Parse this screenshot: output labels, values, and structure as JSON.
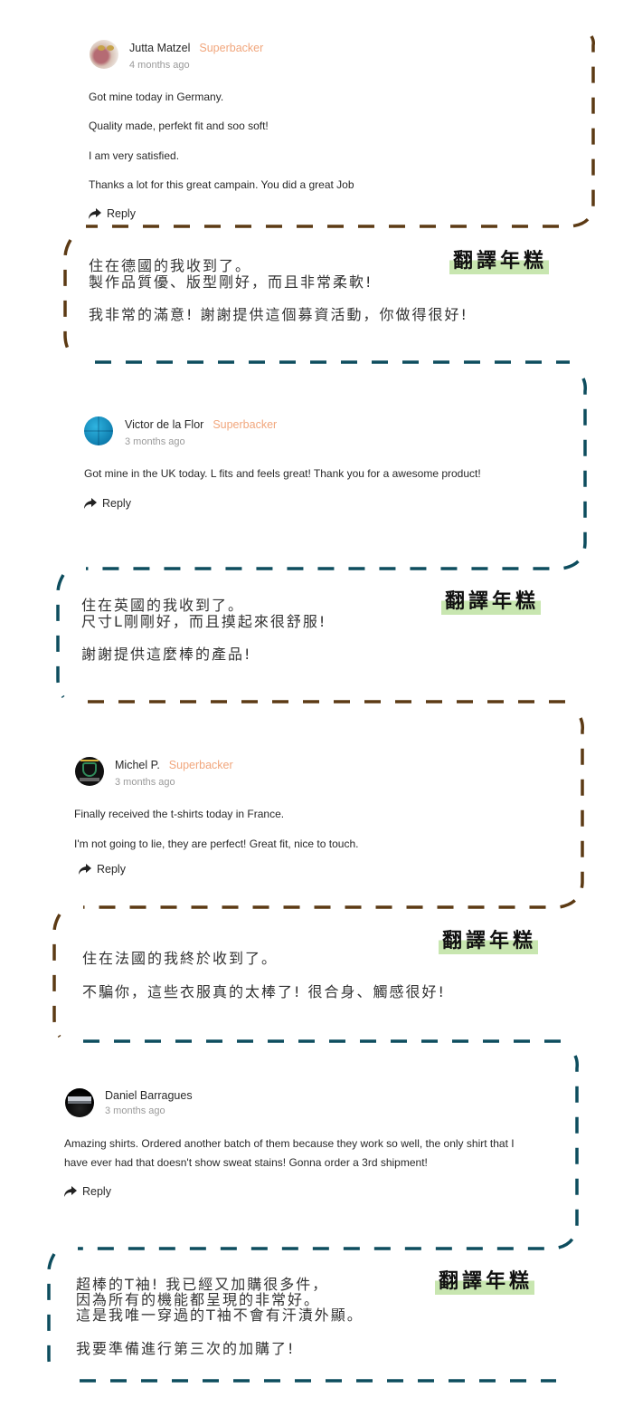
{
  "reply_label": "Reply",
  "translator_label": "翻譯年糕",
  "colors": {
    "brown_dash": "#5c3a14",
    "teal_dash": "#0d4d5e",
    "badge": "#f1a67c",
    "highlight": "#c8e6b0"
  },
  "comments": [
    {
      "author": "Jutta Matzel",
      "badge": "Superbacker",
      "time": "4 months ago",
      "body": [
        "Got mine today in Germany.",
        "Quality made, perfekt fit and soo soft!",
        "I am very satisfied.",
        "Thanks a lot for this great campain. You did a great Job"
      ],
      "translation": [
        "住在德國的我收到了。",
        "製作品質優、版型剛好，而且非常柔軟!",
        "我非常的滿意! 謝謝提供這個募資活動，你做得很好!"
      ]
    },
    {
      "author": "Victor de la Flor",
      "badge": "Superbacker",
      "time": "3 months ago",
      "body": [
        "Got mine in the UK today. L fits and feels great! Thank you for a awesome product!"
      ],
      "translation": [
        "住在英國的我收到了。",
        "尺寸L剛剛好，而且摸起來很舒服!",
        "謝謝提供這麼棒的產品!"
      ]
    },
    {
      "author": "Michel P.",
      "badge": "Superbacker",
      "time": "3 months ago",
      "body": [
        "Finally received the t-shirts today in France.",
        "I'm not going to lie, they are perfect! Great fit, nice to touch."
      ],
      "translation": [
        "住在法國的我終於收到了。",
        "不騙你，這些衣服真的太棒了! 很合身、觸感很好!"
      ]
    },
    {
      "author": "Daniel Barragues",
      "badge": "",
      "time": "3 months ago",
      "body": [
        "Amazing shirts. Ordered another batch of them because they work so well, the only shirt that I",
        "have ever had that doesn't show sweat stains! Gonna order a 3rd shipment!"
      ],
      "translation": [
        "超棒的T袖! 我已經又加購很多件，",
        "因為所有的機能都呈現的非常好。",
        "這是我唯一穿過的T袖不會有汗漬外顯。",
        "我要準備進行第三次的加購了!"
      ]
    }
  ]
}
